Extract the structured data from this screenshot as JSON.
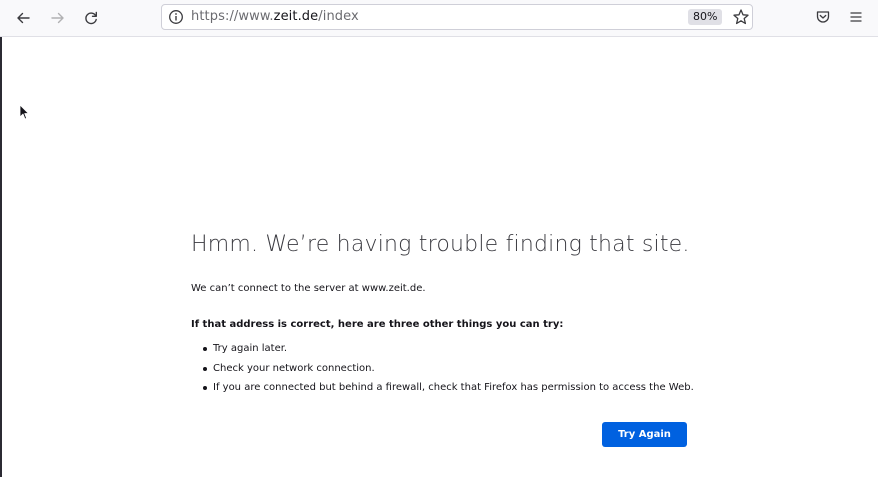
{
  "toolbar": {
    "back_icon": "arrow-left-icon",
    "forward_icon": "arrow-right-icon",
    "reload_icon": "reload-icon",
    "url_prefix": "https://www.",
    "url_host": "zeit.de",
    "url_path": "/index",
    "zoom_label": "80%",
    "bookmark_icon": "star-icon",
    "pocket_icon": "pocket-icon",
    "menu_icon": "hamburger-menu-icon"
  },
  "error_page": {
    "title": "Hmm. We’re having trouble finding that site.",
    "description": "We can’t connect to the server at www.zeit.de.",
    "subheading": "If that address is correct, here are three other things you can try:",
    "tips": [
      "Try again later.",
      "Check your network connection.",
      "If you are connected but behind a firewall, check that Firefox has permission to access the Web."
    ],
    "try_again_label": "Try Again"
  },
  "colors": {
    "accent": "#0061e0",
    "toolbar_bg": "#f9f9fb",
    "text": "#15141a"
  }
}
